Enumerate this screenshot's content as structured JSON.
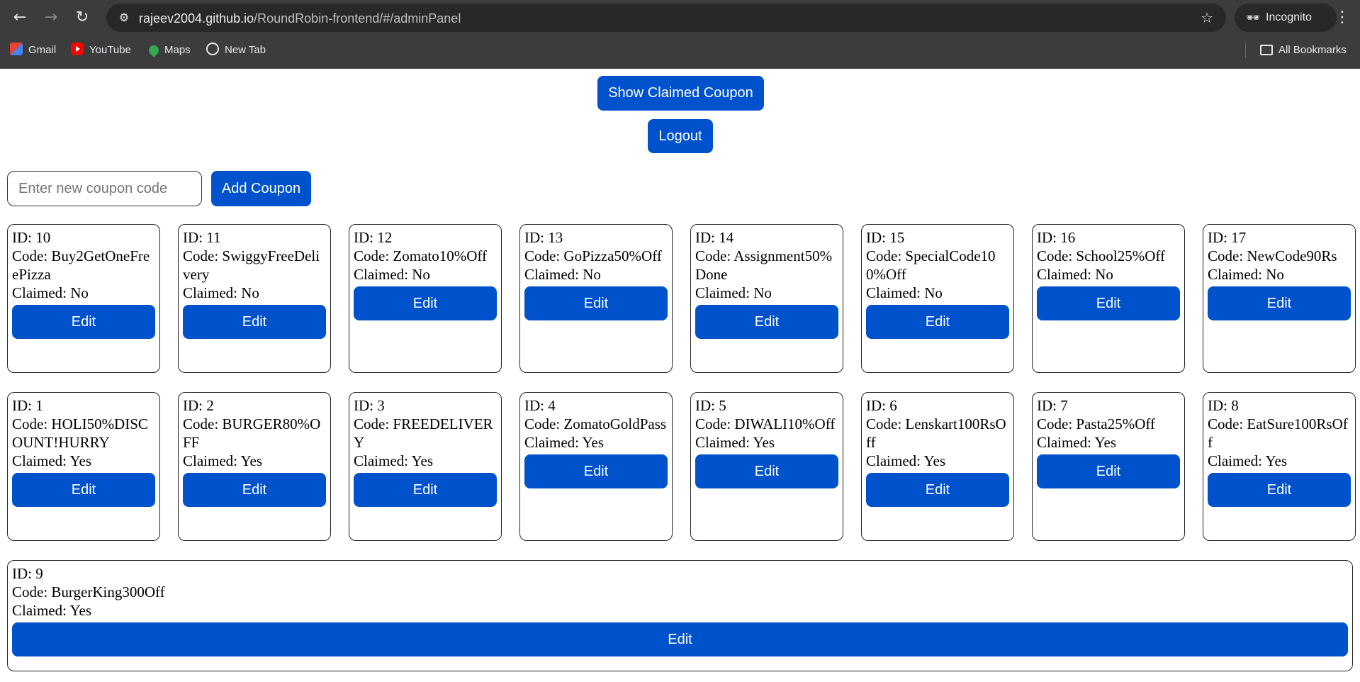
{
  "browser": {
    "url_host": "rajeev2004.github.io",
    "url_path": "/RoundRobin-frontend/#/adminPanel",
    "incognito_label": "Incognito",
    "bookmarks": [
      "Gmail",
      "YouTube",
      "Maps",
      "New Tab"
    ],
    "all_bookmarks": "All Bookmarks"
  },
  "header": {
    "show_claimed_label": "Show Claimed Coupon",
    "logout_label": "Logout"
  },
  "add_form": {
    "placeholder": "Enter new coupon code",
    "value": "",
    "add_label": "Add Coupon"
  },
  "code_prefix": "Code: ",
  "claimed_prefix": "Claimed: ",
  "id_prefix": "ID: ",
  "edit_label": "Edit",
  "coupons": [
    {
      "id": "10",
      "code": "Buy2GetOneFreePizza",
      "claimed": "No"
    },
    {
      "id": "11",
      "code": "SwiggyFreeDelivery",
      "claimed": "No"
    },
    {
      "id": "12",
      "code": "Zomato10%Off",
      "claimed": "No"
    },
    {
      "id": "13",
      "code": "GoPizza50%Off",
      "claimed": "No"
    },
    {
      "id": "14",
      "code": "Assignment50%Done",
      "claimed": "No"
    },
    {
      "id": "15",
      "code": "SpecialCode100%Off",
      "claimed": "No"
    },
    {
      "id": "16",
      "code": "School25%Off",
      "claimed": "No"
    },
    {
      "id": "17",
      "code": "NewCode90Rs",
      "claimed": "No"
    },
    {
      "id": "1",
      "code": "HOLI50%DISCOUNT!HURRY",
      "claimed": "Yes"
    },
    {
      "id": "2",
      "code": "BURGER80%OFF",
      "claimed": "Yes"
    },
    {
      "id": "3",
      "code": "FREEDELIVERY",
      "claimed": "Yes"
    },
    {
      "id": "4",
      "code": "ZomatoGoldPass",
      "claimed": "Yes"
    },
    {
      "id": "5",
      "code": "DIWALI10%Off",
      "claimed": "Yes"
    },
    {
      "id": "6",
      "code": "Lenskart100RsOff",
      "claimed": "Yes"
    },
    {
      "id": "7",
      "code": "Pasta25%Off",
      "claimed": "Yes"
    },
    {
      "id": "8",
      "code": "EatSure100RsOff",
      "claimed": "Yes"
    },
    {
      "id": "9",
      "code": "BurgerKing300Off",
      "claimed": "Yes"
    }
  ],
  "colors": {
    "accent": "#0052cc",
    "chrome_bg": "#3c3c3c",
    "omnibox_bg": "#282828"
  }
}
